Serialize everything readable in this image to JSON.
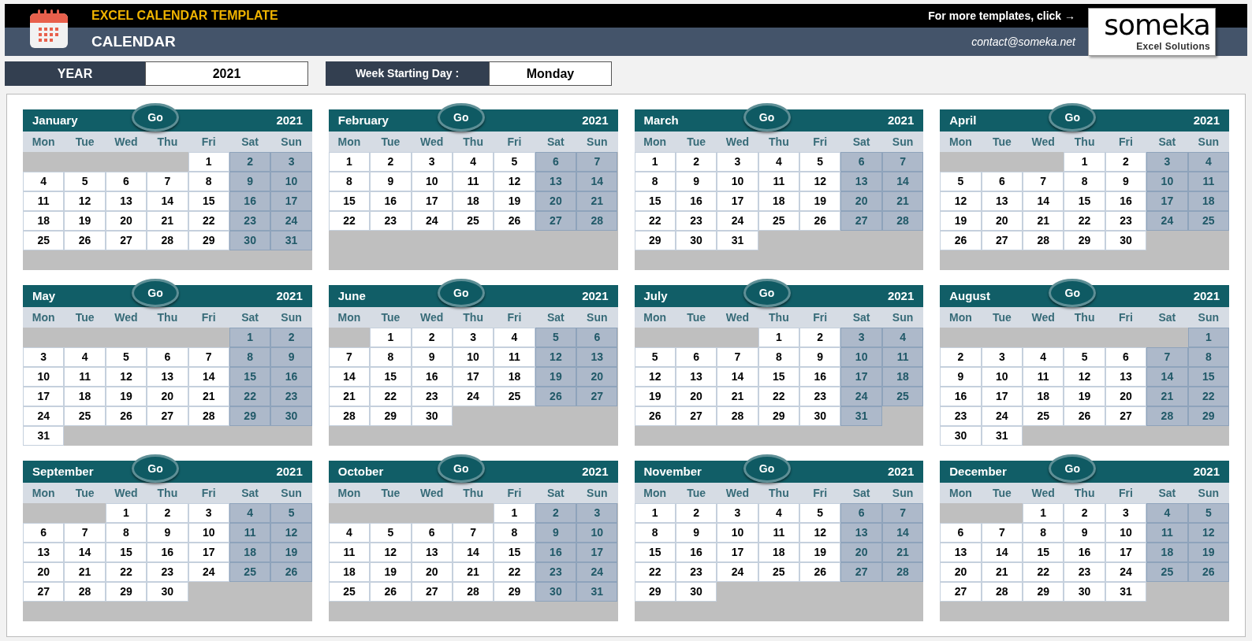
{
  "header": {
    "template_title": "EXCEL CALENDAR TEMPLATE",
    "page_title": "CALENDAR",
    "promo": "For more templates, click →",
    "contact": "contact@someka.net",
    "logo_name": "someka",
    "logo_tagline": "Excel Solutions"
  },
  "settings": [
    {
      "label": "YEAR",
      "value": "2021"
    },
    {
      "label": "Week Starting Day :",
      "value": "Monday"
    }
  ],
  "months": [
    {
      "name": "January",
      "year": "2021",
      "button": "Go",
      "weekdays": [
        {
          "label": "Mon",
          "weekend": false
        },
        {
          "label": "Tue",
          "weekend": false
        },
        {
          "label": "Wed",
          "weekend": false
        },
        {
          "label": "Thu",
          "weekend": false
        },
        {
          "label": "Fri",
          "weekend": false
        },
        {
          "label": "Sat",
          "weekend": true
        },
        {
          "label": "Sun",
          "weekend": true
        }
      ],
      "weeks": [
        {
          "kind": "lead",
          "days": [
            "1",
            "2",
            "3"
          ]
        },
        {
          "kind": "week",
          "days": [
            "4",
            "5",
            "6",
            "7",
            "8",
            "9",
            "10"
          ]
        },
        {
          "kind": "week",
          "days": [
            "11",
            "12",
            "13",
            "14",
            "15",
            "16",
            "17"
          ]
        },
        {
          "kind": "week",
          "days": [
            "18",
            "19",
            "20",
            "21",
            "22",
            "23",
            "24"
          ]
        },
        {
          "kind": "week",
          "days": [
            "25",
            "26",
            "27",
            "28",
            "29",
            "30",
            "31"
          ]
        }
      ]
    },
    {
      "name": "February",
      "year": "2021",
      "button": "Go",
      "weekdays": [
        {
          "label": "Mon",
          "weekend": false
        },
        {
          "label": "Tue",
          "weekend": false
        },
        {
          "label": "Wed",
          "weekend": false
        },
        {
          "label": "Thu",
          "weekend": false
        },
        {
          "label": "Fri",
          "weekend": false
        },
        {
          "label": "Sat",
          "weekend": true
        },
        {
          "label": "Sun",
          "weekend": true
        }
      ],
      "weeks": [
        {
          "kind": "week",
          "days": [
            "1",
            "2",
            "3",
            "4",
            "5",
            "6",
            "7"
          ]
        },
        {
          "kind": "week",
          "days": [
            "8",
            "9",
            "10",
            "11",
            "12",
            "13",
            "14"
          ]
        },
        {
          "kind": "week",
          "days": [
            "15",
            "16",
            "17",
            "18",
            "19",
            "20",
            "21"
          ]
        },
        {
          "kind": "week",
          "days": [
            "22",
            "23",
            "24",
            "25",
            "26",
            "27",
            "28"
          ]
        }
      ]
    },
    {
      "name": "March",
      "year": "2021",
      "button": "Go",
      "weekdays": [
        {
          "label": "Mon",
          "weekend": false
        },
        {
          "label": "Tue",
          "weekend": false
        },
        {
          "label": "Wed",
          "weekend": false
        },
        {
          "label": "Thu",
          "weekend": false
        },
        {
          "label": "Fri",
          "weekend": false
        },
        {
          "label": "Sat",
          "weekend": true
        },
        {
          "label": "Sun",
          "weekend": true
        }
      ],
      "weeks": [
        {
          "kind": "week",
          "days": [
            "1",
            "2",
            "3",
            "4",
            "5",
            "6",
            "7"
          ]
        },
        {
          "kind": "week",
          "days": [
            "8",
            "9",
            "10",
            "11",
            "12",
            "13",
            "14"
          ]
        },
        {
          "kind": "week",
          "days": [
            "15",
            "16",
            "17",
            "18",
            "19",
            "20",
            "21"
          ]
        },
        {
          "kind": "week",
          "days": [
            "22",
            "23",
            "24",
            "25",
            "26",
            "27",
            "28"
          ]
        },
        {
          "kind": "week",
          "days": [
            "29",
            "30",
            "31"
          ]
        }
      ]
    },
    {
      "name": "April",
      "year": "2021",
      "button": "Go",
      "weekdays": [
        {
          "label": "Mon",
          "weekend": false
        },
        {
          "label": "Tue",
          "weekend": false
        },
        {
          "label": "Wed",
          "weekend": false
        },
        {
          "label": "Thu",
          "weekend": false
        },
        {
          "label": "Fri",
          "weekend": false
        },
        {
          "label": "Sat",
          "weekend": true
        },
        {
          "label": "Sun",
          "weekend": true
        }
      ],
      "weeks": [
        {
          "kind": "lead",
          "days": [
            "1",
            "2",
            "3",
            "4"
          ]
        },
        {
          "kind": "week",
          "days": [
            "5",
            "6",
            "7",
            "8",
            "9",
            "10",
            "11"
          ]
        },
        {
          "kind": "week",
          "days": [
            "12",
            "13",
            "14",
            "15",
            "16",
            "17",
            "18"
          ]
        },
        {
          "kind": "week",
          "days": [
            "19",
            "20",
            "21",
            "22",
            "23",
            "24",
            "25"
          ]
        },
        {
          "kind": "week",
          "days": [
            "26",
            "27",
            "28",
            "29",
            "30"
          ]
        }
      ]
    },
    {
      "name": "May",
      "year": "2021",
      "button": "Go",
      "weekdays": [
        {
          "label": "Mon",
          "weekend": false
        },
        {
          "label": "Tue",
          "weekend": false
        },
        {
          "label": "Wed",
          "weekend": false
        },
        {
          "label": "Thu",
          "weekend": false
        },
        {
          "label": "Fri",
          "weekend": false
        },
        {
          "label": "Sat",
          "weekend": true
        },
        {
          "label": "Sun",
          "weekend": true
        }
      ],
      "weeks": [
        {
          "kind": "lead",
          "days": [
            "1",
            "2"
          ]
        },
        {
          "kind": "week",
          "days": [
            "3",
            "4",
            "5",
            "6",
            "7",
            "8",
            "9"
          ]
        },
        {
          "kind": "week",
          "days": [
            "10",
            "11",
            "12",
            "13",
            "14",
            "15",
            "16"
          ]
        },
        {
          "kind": "week",
          "days": [
            "17",
            "18",
            "19",
            "20",
            "21",
            "22",
            "23"
          ]
        },
        {
          "kind": "week",
          "days": [
            "24",
            "25",
            "26",
            "27",
            "28",
            "29",
            "30"
          ]
        },
        {
          "kind": "week",
          "days": [
            "31"
          ]
        }
      ]
    },
    {
      "name": "June",
      "year": "2021",
      "button": "Go",
      "weekdays": [
        {
          "label": "Mon",
          "weekend": false
        },
        {
          "label": "Tue",
          "weekend": false
        },
        {
          "label": "Wed",
          "weekend": false
        },
        {
          "label": "Thu",
          "weekend": false
        },
        {
          "label": "Fri",
          "weekend": false
        },
        {
          "label": "Sat",
          "weekend": true
        },
        {
          "label": "Sun",
          "weekend": true
        }
      ],
      "weeks": [
        {
          "kind": "lead",
          "days": [
            "1",
            "2",
            "3",
            "4",
            "5",
            "6"
          ]
        },
        {
          "kind": "week",
          "days": [
            "7",
            "8",
            "9",
            "10",
            "11",
            "12",
            "13"
          ]
        },
        {
          "kind": "week",
          "days": [
            "14",
            "15",
            "16",
            "17",
            "18",
            "19",
            "20"
          ]
        },
        {
          "kind": "week",
          "days": [
            "21",
            "22",
            "23",
            "24",
            "25",
            "26",
            "27"
          ]
        },
        {
          "kind": "week",
          "days": [
            "28",
            "29",
            "30"
          ]
        }
      ]
    },
    {
      "name": "July",
      "year": "2021",
      "button": "Go",
      "weekdays": [
        {
          "label": "Mon",
          "weekend": false
        },
        {
          "label": "Tue",
          "weekend": false
        },
        {
          "label": "Wed",
          "weekend": false
        },
        {
          "label": "Thu",
          "weekend": false
        },
        {
          "label": "Fri",
          "weekend": false
        },
        {
          "label": "Sat",
          "weekend": true
        },
        {
          "label": "Sun",
          "weekend": true
        }
      ],
      "weeks": [
        {
          "kind": "lead",
          "days": [
            "1",
            "2",
            "3",
            "4"
          ]
        },
        {
          "kind": "week",
          "days": [
            "5",
            "6",
            "7",
            "8",
            "9",
            "10",
            "11"
          ]
        },
        {
          "kind": "week",
          "days": [
            "12",
            "13",
            "14",
            "15",
            "16",
            "17",
            "18"
          ]
        },
        {
          "kind": "week",
          "days": [
            "19",
            "20",
            "21",
            "22",
            "23",
            "24",
            "25"
          ]
        },
        {
          "kind": "week",
          "days": [
            "26",
            "27",
            "28",
            "29",
            "30",
            "31"
          ]
        }
      ]
    },
    {
      "name": "August",
      "year": "2021",
      "button": "Go",
      "weekdays": [
        {
          "label": "Mon",
          "weekend": false
        },
        {
          "label": "Tue",
          "weekend": false
        },
        {
          "label": "Wed",
          "weekend": false
        },
        {
          "label": "Thu",
          "weekend": false
        },
        {
          "label": "Fri",
          "weekend": false
        },
        {
          "label": "Sat",
          "weekend": true
        },
        {
          "label": "Sun",
          "weekend": true
        }
      ],
      "weeks": [
        {
          "kind": "lead",
          "days": [
            "1"
          ]
        },
        {
          "kind": "week",
          "days": [
            "2",
            "3",
            "4",
            "5",
            "6",
            "7",
            "8"
          ]
        },
        {
          "kind": "week",
          "days": [
            "9",
            "10",
            "11",
            "12",
            "13",
            "14",
            "15"
          ]
        },
        {
          "kind": "week",
          "days": [
            "16",
            "17",
            "18",
            "19",
            "20",
            "21",
            "22"
          ]
        },
        {
          "kind": "week",
          "days": [
            "23",
            "24",
            "25",
            "26",
            "27",
            "28",
            "29"
          ]
        },
        {
          "kind": "week",
          "days": [
            "30",
            "31"
          ]
        }
      ]
    },
    {
      "name": "September",
      "year": "2021",
      "button": "Go",
      "weekdays": [
        {
          "label": "Mon",
          "weekend": false
        },
        {
          "label": "Tue",
          "weekend": false
        },
        {
          "label": "Wed",
          "weekend": false
        },
        {
          "label": "Thu",
          "weekend": false
        },
        {
          "label": "Fri",
          "weekend": false
        },
        {
          "label": "Sat",
          "weekend": true
        },
        {
          "label": "Sun",
          "weekend": true
        }
      ],
      "weeks": [
        {
          "kind": "lead",
          "days": [
            "1",
            "2",
            "3",
            "4",
            "5"
          ]
        },
        {
          "kind": "week",
          "days": [
            "6",
            "7",
            "8",
            "9",
            "10",
            "11",
            "12"
          ]
        },
        {
          "kind": "week",
          "days": [
            "13",
            "14",
            "15",
            "16",
            "17",
            "18",
            "19"
          ]
        },
        {
          "kind": "week",
          "days": [
            "20",
            "21",
            "22",
            "23",
            "24",
            "25",
            "26"
          ]
        },
        {
          "kind": "week",
          "days": [
            "27",
            "28",
            "29",
            "30"
          ]
        }
      ]
    },
    {
      "name": "October",
      "year": "2021",
      "button": "Go",
      "weekdays": [
        {
          "label": "Mon",
          "weekend": false
        },
        {
          "label": "Tue",
          "weekend": false
        },
        {
          "label": "Wed",
          "weekend": false
        },
        {
          "label": "Thu",
          "weekend": false
        },
        {
          "label": "Fri",
          "weekend": false
        },
        {
          "label": "Sat",
          "weekend": true
        },
        {
          "label": "Sun",
          "weekend": true
        }
      ],
      "weeks": [
        {
          "kind": "lead",
          "days": [
            "1",
            "2",
            "3"
          ]
        },
        {
          "kind": "week",
          "days": [
            "4",
            "5",
            "6",
            "7",
            "8",
            "9",
            "10"
          ]
        },
        {
          "kind": "week",
          "days": [
            "11",
            "12",
            "13",
            "14",
            "15",
            "16",
            "17"
          ]
        },
        {
          "kind": "week",
          "days": [
            "18",
            "19",
            "20",
            "21",
            "22",
            "23",
            "24"
          ]
        },
        {
          "kind": "week",
          "days": [
            "25",
            "26",
            "27",
            "28",
            "29",
            "30",
            "31"
          ]
        }
      ]
    },
    {
      "name": "November",
      "year": "2021",
      "button": "Go",
      "weekdays": [
        {
          "label": "Mon",
          "weekend": false
        },
        {
          "label": "Tue",
          "weekend": false
        },
        {
          "label": "Wed",
          "weekend": false
        },
        {
          "label": "Thu",
          "weekend": false
        },
        {
          "label": "Fri",
          "weekend": false
        },
        {
          "label": "Sat",
          "weekend": true
        },
        {
          "label": "Sun",
          "weekend": true
        }
      ],
      "weeks": [
        {
          "kind": "week",
          "days": [
            "1",
            "2",
            "3",
            "4",
            "5",
            "6",
            "7"
          ]
        },
        {
          "kind": "week",
          "days": [
            "8",
            "9",
            "10",
            "11",
            "12",
            "13",
            "14"
          ]
        },
        {
          "kind": "week",
          "days": [
            "15",
            "16",
            "17",
            "18",
            "19",
            "20",
            "21"
          ]
        },
        {
          "kind": "week",
          "days": [
            "22",
            "23",
            "24",
            "25",
            "26",
            "27",
            "28"
          ]
        },
        {
          "kind": "week",
          "days": [
            "29",
            "30"
          ]
        }
      ]
    },
    {
      "name": "December",
      "year": "2021",
      "button": "Go",
      "weekdays": [
        {
          "label": "Mon",
          "weekend": false
        },
        {
          "label": "Tue",
          "weekend": false
        },
        {
          "label": "Wed",
          "weekend": false
        },
        {
          "label": "Thu",
          "weekend": false
        },
        {
          "label": "Fri",
          "weekend": false
        },
        {
          "label": "Sat",
          "weekend": true
        },
        {
          "label": "Sun",
          "weekend": true
        }
      ],
      "weeks": [
        {
          "kind": "lead",
          "days": [
            "1",
            "2",
            "3",
            "4",
            "5"
          ]
        },
        {
          "kind": "week",
          "days": [
            "6",
            "7",
            "8",
            "9",
            "10",
            "11",
            "12"
          ]
        },
        {
          "kind": "week",
          "days": [
            "13",
            "14",
            "15",
            "16",
            "17",
            "18",
            "19"
          ]
        },
        {
          "kind": "week",
          "days": [
            "20",
            "21",
            "22",
            "23",
            "24",
            "25",
            "26"
          ]
        },
        {
          "kind": "week",
          "days": [
            "27",
            "28",
            "29",
            "30",
            "31"
          ]
        }
      ]
    }
  ]
}
